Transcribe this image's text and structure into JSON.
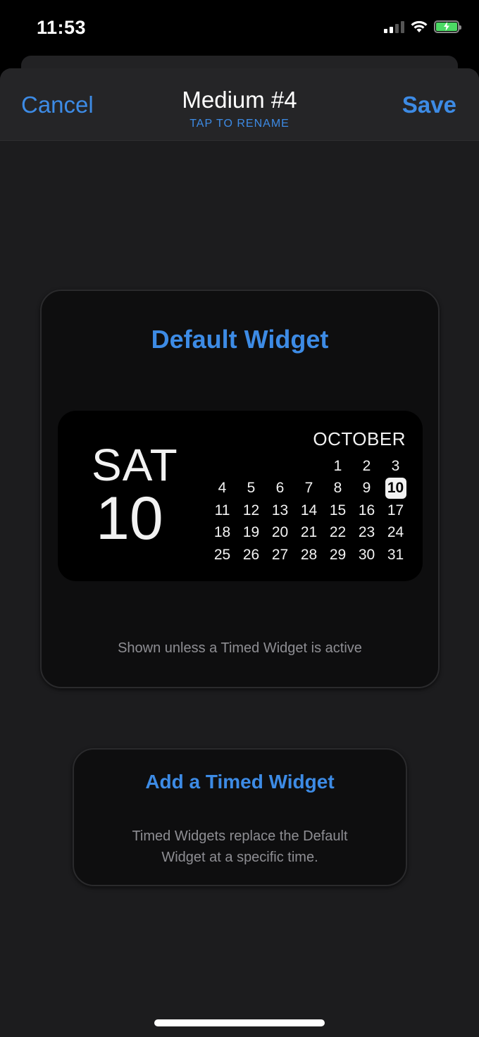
{
  "status_bar": {
    "time": "11:53",
    "signal_bars_active": 2,
    "signal_bars_total": 4,
    "wifi_icon": "wifi-icon",
    "battery_icon": "battery-charging-icon",
    "battery_color": "#4cd964"
  },
  "nav": {
    "cancel_label": "Cancel",
    "title": "Medium #4",
    "subtitle": "TAP TO RENAME",
    "save_label": "Save",
    "accent_color": "#3d8be5"
  },
  "default_widget": {
    "title": "Default Widget",
    "preview": {
      "day_name": "SAT",
      "day_number": "10",
      "month": "OCTOBER",
      "leading_blanks": 4,
      "days_in_month": 31,
      "today": 10
    },
    "description": "Shown unless a Timed Widget is active"
  },
  "timed_widget": {
    "title": "Add a Timed Widget",
    "description_line1": "Timed Widgets replace the Default",
    "description_line2": "Widget at a specific time."
  }
}
